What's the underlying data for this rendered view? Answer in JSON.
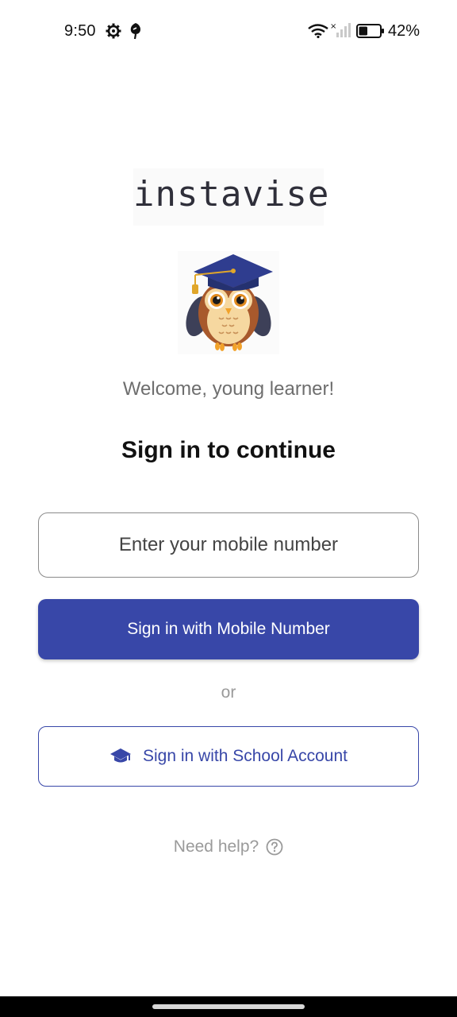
{
  "status_bar": {
    "time": "9:50",
    "battery_percent": "42%",
    "battery_level": 0.42,
    "icons": [
      "gear-icon",
      "leaf-icon",
      "wifi-icon",
      "signal-icon",
      "battery-icon"
    ]
  },
  "logo": {
    "text": "instavise"
  },
  "mascot": {
    "icon": "owl-graduate-icon"
  },
  "welcome_text": "Welcome, young learner!",
  "title": "Sign in to continue",
  "mobile_input": {
    "placeholder": "Enter your mobile number",
    "value": ""
  },
  "mobile_button": {
    "label": "Sign in with Mobile Number"
  },
  "divider_text": "or",
  "school_button": {
    "label": "Sign in with School Account",
    "icon": "graduation-cap-icon"
  },
  "help": {
    "label": "Need help?",
    "icon": "help-circle-icon"
  },
  "colors": {
    "primary": "#3847a8",
    "muted_text": "#9a9a9a",
    "welcome_text": "#6e6e6e"
  }
}
